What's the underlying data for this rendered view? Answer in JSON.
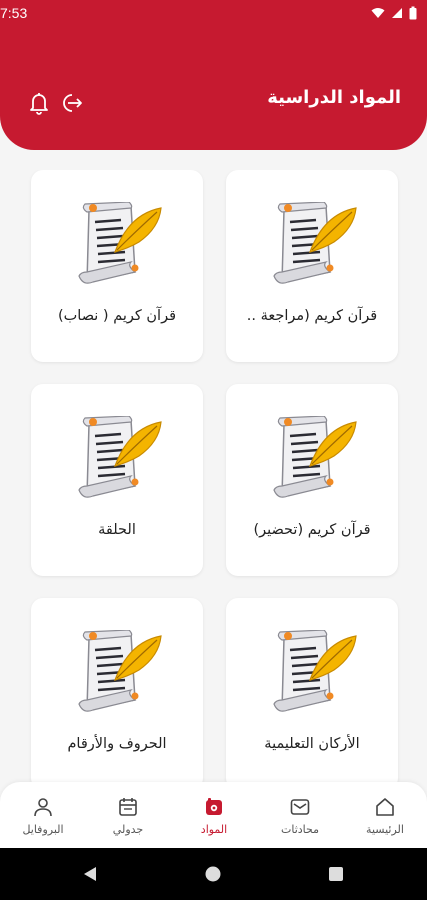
{
  "status_bar": {
    "time": "7:53"
  },
  "header": {
    "title": "المواد الدراسية",
    "bg_color": "#c61a30"
  },
  "subjects": [
    {
      "label": "قرآن كريم (مراجعة .."
    },
    {
      "label": "قرآن كريم ( نصاب)"
    },
    {
      "label": "قرآن كريم (تحضير)"
    },
    {
      "label": "الحلقة"
    },
    {
      "label": "الأركان التعليمية"
    },
    {
      "label": "الحروف والأرقام"
    }
  ],
  "bottom_nav": [
    {
      "label": "الرئيسية",
      "icon": "home-icon",
      "active": false
    },
    {
      "label": "محادثات",
      "icon": "mail-icon",
      "active": false
    },
    {
      "label": "المواد",
      "icon": "subjects-icon",
      "active": true
    },
    {
      "label": "جدولي",
      "icon": "schedule-icon",
      "active": false
    },
    {
      "label": "البروفايل",
      "icon": "profile-icon",
      "active": false
    }
  ],
  "colors": {
    "accent": "#c61a30",
    "background": "#f5f5f5"
  }
}
